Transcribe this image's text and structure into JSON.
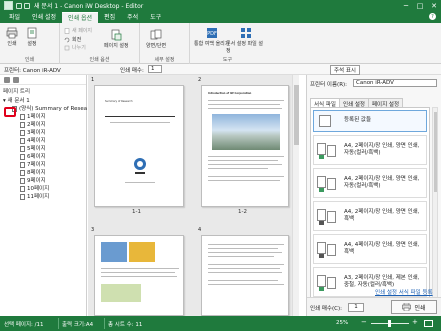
{
  "window": {
    "title": "새 문서 1 - Canon iW Desktop - Editor",
    "controls": [
      "─",
      "□",
      "✕"
    ]
  },
  "tabs": [
    "파일",
    "인쇄 설정",
    "인쇄 옵션",
    "편집",
    "주석",
    "도구"
  ],
  "active_tab_index": 2,
  "ribbon": {
    "groups": [
      {
        "label": "인쇄"
      },
      {
        "label": "인쇄 옵션"
      },
      {
        "label": "세부 설정"
      },
      {
        "label": "도구"
      }
    ],
    "print_button": "인쇄",
    "settings_button": "설정",
    "small_new_page": "새 페이지",
    "small_rotate": "회전",
    "small_split": "나누기",
    "page_settings": "페이지 설정",
    "duplex_label": "양면/단면",
    "combine_button": "통합 여백 올리기",
    "detail_button": "문서 설정 파일 설정"
  },
  "toolbar2": {
    "printer_label": "프린터:",
    "printer_value": "Canon iR-ADV",
    "duplex_label": "인쇄 매수:",
    "copies_value": "1",
    "annotation_button": "주석 표시"
  },
  "left_pane": {
    "title": "페이지 트리",
    "doc_root": "새 문서 1",
    "doc_item": "(양식) Summary of Resea",
    "pages": [
      "1페이지",
      "2페이지",
      "3페이지",
      "4페이지",
      "5페이지",
      "6페이지",
      "7페이지",
      "8페이지",
      "9페이지",
      "10페이지",
      "11페이지"
    ]
  },
  "mid_pane": {
    "page_numbers": [
      "1",
      "2",
      "3",
      "4"
    ],
    "labels": [
      "1-1",
      "1-2"
    ],
    "page1_heading": "Summary of Research",
    "page2_heading": "Introduction of IW Corporation"
  },
  "right_pane": {
    "printer_label": "프린터 이름(R):",
    "printer_value": "Canon iR-ADV",
    "tabs": [
      "서식 파일",
      "인쇄 설정",
      "페이지 설정"
    ],
    "presets": [
      {
        "label": "등록된 값들"
      },
      {
        "label": "A4, 2페이지/장 인쇄, 양면 인쇄, 자동(컬러/흑백)"
      },
      {
        "label": "A4, 2페이지/장 인쇄, 양면 인쇄, 자동(컬러/흑백)"
      },
      {
        "label": "A4, 2페이지/장 인쇄, 양면 인쇄, 흑백"
      },
      {
        "label": "A4, 4페이지/장 인쇄, 양면 인쇄, 흑백"
      },
      {
        "label": "A3, 2페이지/장 인쇄, 제본 인쇄, 중철, 자동(컬러/흑백)"
      }
    ],
    "selected_preset_index": 0,
    "manage_link": "인쇄 설정 서식 파일 등록",
    "copies_label": "인쇄 매수(C):",
    "copies_value": "1",
    "print_button": "인쇄"
  },
  "status": {
    "selected": "선택 페이지: /11",
    "output_size": "출력 크기:A4",
    "total": "총 시트 수: 11",
    "zoom": "25%"
  },
  "colors": {
    "accent": "#1f7a3d",
    "highlight": "#e0001b"
  }
}
